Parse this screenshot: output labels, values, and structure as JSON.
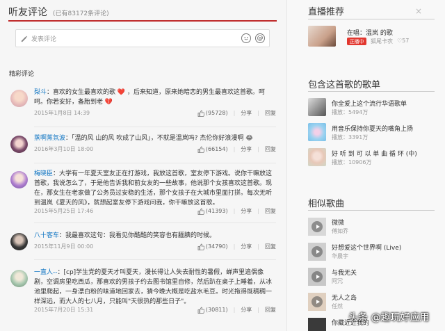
{
  "comments_header": {
    "title": "听友评论",
    "count": "(已有83172条评论)",
    "input_placeholder": "发表评论",
    "section_title": "精彩评论"
  },
  "comments": [
    {
      "user": "梨斗",
      "text": "：喜欢的女生最喜欢的歌 ❤️ ，后来知道，原来她暗恋的男生最喜欢这首歌。呵呵。你若安好，备胎到老 💔",
      "date": "2015年1月8日 14:39",
      "likes": "(95728)",
      "share": "分享",
      "reply": "回复"
    },
    {
      "user": "蒸啊蒸氛波",
      "text": "：「温的风 山的风 吹成了山风」，不就是温岚吗? 杰伦你好浪漫啊 😂",
      "date": "2016年3月10日 18:00",
      "likes": "(66154)",
      "share": "分享",
      "reply": "回复"
    },
    {
      "user": "梅晓臣",
      "text": "：大学有一年夏天室友正在打游戏，我放这首歌，室友停下游戏。说你干嘛放这首歌，我说怎么了，于是他告诉我和前女友的一些故事，他说那个女孩喜欢这首歌。现在，那女生在老家做了公务员过安稳的生活，那个女孩子在大城市里面打拼。每次无听到温岚《夏天的风》，就想起室友停下游戏问我，你干嘛放这首歌。",
      "date": "2015年5月25日 17:46",
      "likes": "(41393)",
      "share": "分享",
      "reply": "回复"
    },
    {
      "user": "八十客车",
      "text": "：我最喜欢这句：我看见你酷酷的笑容也有腼腆的时候。",
      "date": "2015年11月9日 00:00",
      "likes": "(34790)",
      "share": "分享",
      "reply": "回复"
    },
    {
      "user": "一直人--",
      "text": "：[cp]学生党的夏天才叫夏天，漫长得让人失去耐性的暑假，蝉声里追偶像剧，空调房里吃西瓜，那喜欢的男孩子约去图书馆里自修，然后趴在桌子上睡着，从冰池里爬起，一身漂白粉的味道地回家去，猜今晚大概是吃盐水毛豆。时光拖得既稠稠一样深远，而大人的七八月，只能叫\"天很热的那些日子\"。",
      "date": "2015年7月20日 15:31",
      "likes": "(30811)",
      "share": "分享",
      "reply": "回复"
    }
  ],
  "live": {
    "title": "直播推荐",
    "close": "×",
    "item_title": "在唱：温岚 的歌",
    "badge": "正播中",
    "host": "狐尾卡农",
    "heart": "♡57"
  },
  "playlists": {
    "title": "包含这首歌的歌单",
    "items": [
      {
        "name": "你全爱上这个流行华语歌单",
        "plays": "播放：5494万"
      },
      {
        "name": "用音乐保持你夏天的嘴角上扬",
        "plays": "播放：3391万"
      },
      {
        "name": "好 听 到 可 以 单 曲 循 环 (中)",
        "plays": "播放：10906万"
      }
    ]
  },
  "similar": {
    "title": "相似歌曲",
    "items": [
      {
        "name": "微微",
        "artist": "傅如乔"
      },
      {
        "name": "好想爱这个世界啊 (Live)",
        "artist": "华晨宇"
      },
      {
        "name": "与我无关",
        "artist": "阿冗"
      },
      {
        "name": "无人之岛",
        "artist": "任然"
      },
      {
        "name": "你藏近近我的",
        "artist": ""
      }
    ]
  },
  "watermark": "头条 @趣玩好应用",
  "colors": {
    "accent": "#bf2a2a",
    "link": "#0c73c2",
    "live_badge": "#e2372f"
  }
}
